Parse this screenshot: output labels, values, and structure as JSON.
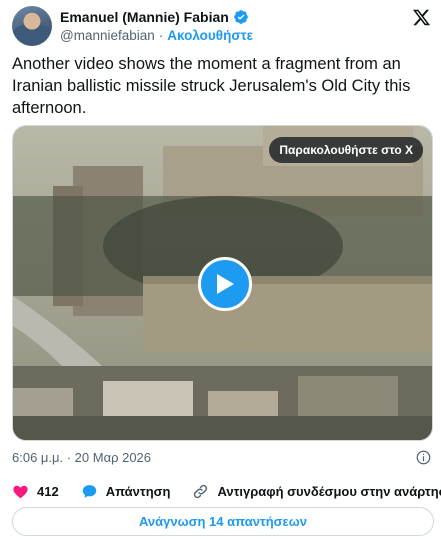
{
  "author": {
    "name": "Emanuel (Mannie) Fabian",
    "handle": "@manniefabian",
    "separator": "·",
    "follow_label": "Ακολουθήστε",
    "verified_icon": "verified-badge-icon"
  },
  "tweet": {
    "text": "Another video shows the moment a fragment from an Iranian ballistic missile struck Jerusalem's Old City this afternoon."
  },
  "media": {
    "watch_label": "Παρακολουθήστε στο X",
    "play_icon": "play-icon"
  },
  "meta": {
    "timestamp": "6:06 μ.μ. · 20 Μαρ 2026"
  },
  "actions": {
    "likes": "412",
    "reply_label": "Απάντηση",
    "copy_link_label": "Αντιγραφή συνδέσμου στην ανάρτηση"
  },
  "replies_button": "Ανάγνωση 14 απαντήσεων",
  "colors": {
    "accent": "#1d9bf0",
    "like": "#f91880",
    "muted": "#536471"
  }
}
